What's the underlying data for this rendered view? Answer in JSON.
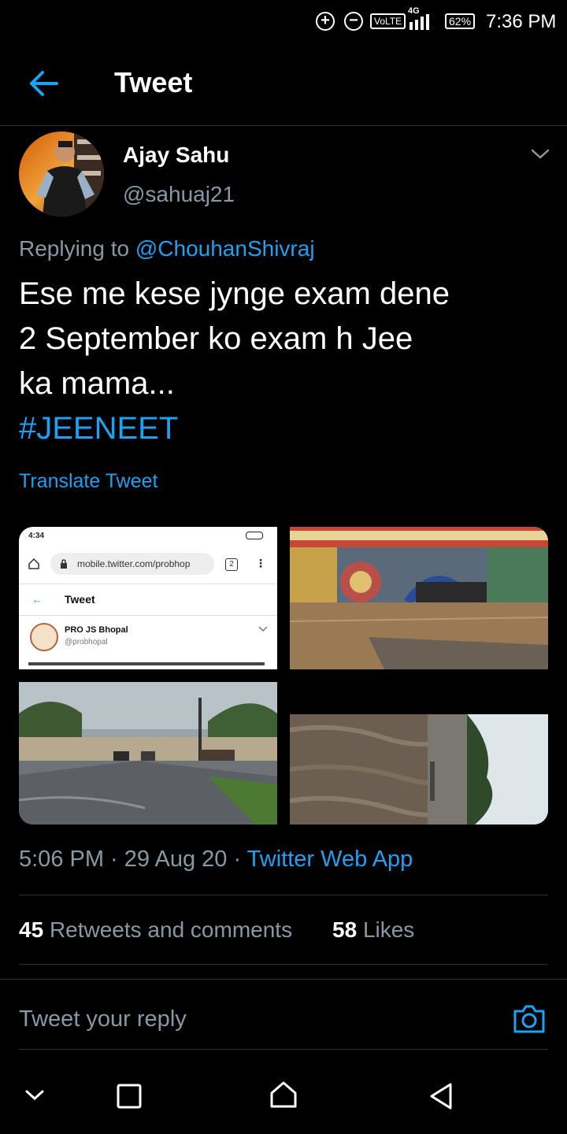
{
  "status_bar": {
    "volte": "VoLTE",
    "net": "4G",
    "battery": "62%",
    "time": "7:36 PM"
  },
  "header": {
    "title": "Tweet"
  },
  "tweet": {
    "author_name": "Ajay Sahu",
    "author_handle": "@sahuaj21",
    "replying_prefix": "Replying to",
    "replying_to": "@ChouhanShivraj",
    "text_line1": "Ese me kese jynge exam dene",
    "text_line2": "2 September ko exam h Jee",
    "text_line3": "ka mama...",
    "hashtag": "#JEENEET",
    "translate": "Translate Tweet",
    "timestamp": "5:06 PM · 29 Aug 20 ·",
    "source": "Twitter Web App",
    "retweets_count": "45",
    "retweets_label": "Retweets and comments",
    "likes_count": "58",
    "likes_label": "Likes"
  },
  "embedded_screenshot": {
    "time": "4:34",
    "url": "mobile.twitter.com/probhop",
    "tabs": "2",
    "title": "Tweet",
    "name": "PRO JS Bhopal",
    "handle": "@probhopal"
  },
  "reply": {
    "placeholder": "Tweet your reply"
  }
}
